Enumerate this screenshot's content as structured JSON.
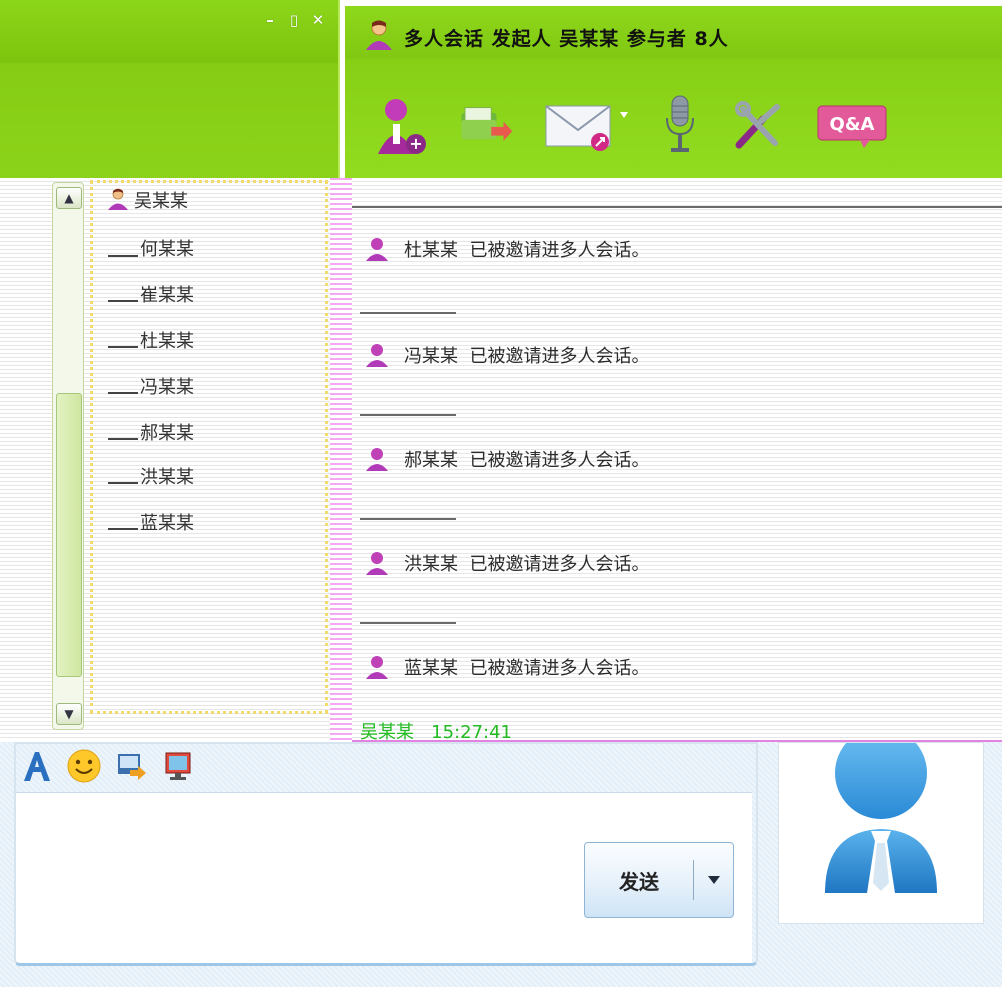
{
  "window": {
    "title": "多人会话  发起人  吴某某  参与者  8人",
    "controls": [
      "minimize-icon",
      "maximize-icon",
      "close-icon"
    ]
  },
  "toolbar": {
    "buttons": [
      {
        "name": "add-member-button",
        "icon": "add-user-icon"
      },
      {
        "name": "send-file-button",
        "icon": "send-file-icon"
      },
      {
        "name": "mail-button",
        "icon": "mail-icon",
        "has_dropdown": true
      },
      {
        "name": "voice-button",
        "icon": "microphone-icon"
      },
      {
        "name": "settings-button",
        "icon": "tools-icon"
      },
      {
        "name": "qa-button",
        "icon": "qa-icon",
        "label": "Q&A"
      }
    ]
  },
  "members": {
    "items": [
      "吴某某",
      "何某某",
      "崔某某",
      "杜某某",
      "冯某某",
      "郝某某",
      "洪某某",
      "蓝某某"
    ]
  },
  "chat": {
    "messages": [
      {
        "name": "杜某某",
        "text": "已被邀请进多人会话。"
      },
      {
        "name": "冯某某",
        "text": "已被邀请进多人会话。"
      },
      {
        "name": "郝某某",
        "text": "已被邀请进多人会话。"
      },
      {
        "name": "洪某某",
        "text": "已被邀请进多人会话。"
      },
      {
        "name": "蓝某某",
        "text": "已被邀请进多人会话。"
      }
    ],
    "last_sender": "吴某某",
    "last_time": "15:27:41"
  },
  "input": {
    "tools": [
      "font-icon",
      "emoji-icon",
      "send-image-icon",
      "screen-share-icon"
    ],
    "send_label": "发送"
  },
  "colors": {
    "title_green": "#86cc14",
    "member_purple": "#b03ab8",
    "sender_green": "#22bb22",
    "accent_blue": "#3aa0e6"
  }
}
